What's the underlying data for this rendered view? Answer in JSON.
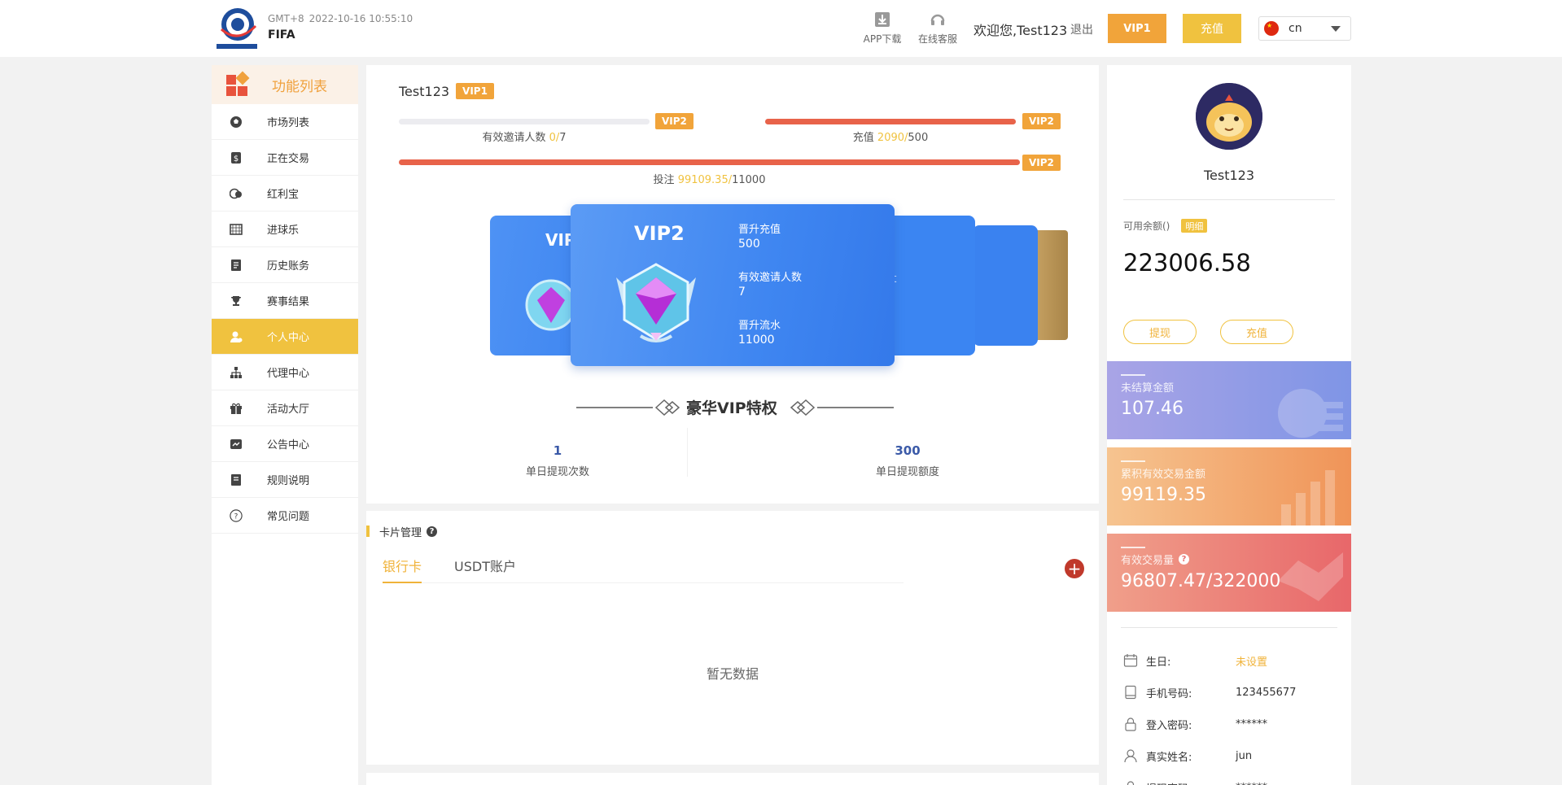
{
  "header": {
    "timezone": "GMT+8",
    "datetime": "2022-10-16 10:55:10",
    "brand": "FIFA",
    "app_download": "APP下载",
    "online_service": "在线客服",
    "welcome": "欢迎您,Test123",
    "logout": "退出",
    "vip_button": "VIP1",
    "recharge_button": "充值",
    "language": "cn"
  },
  "sidebar": {
    "title": "功能列表",
    "items": [
      {
        "label": "市场列表",
        "icon": "soccer-ball-icon"
      },
      {
        "label": "正在交易",
        "icon": "dollar-doc-icon"
      },
      {
        "label": "红利宝",
        "icon": "coins-icon"
      },
      {
        "label": "进球乐",
        "icon": "goal-net-icon"
      },
      {
        "label": "历史账务",
        "icon": "ledger-icon"
      },
      {
        "label": "赛事结果",
        "icon": "trophy-icon"
      },
      {
        "label": "个人中心",
        "icon": "user-icon",
        "active": true
      },
      {
        "label": "代理中心",
        "icon": "org-chart-icon"
      },
      {
        "label": "活动大厅",
        "icon": "gift-icon"
      },
      {
        "label": "公告中心",
        "icon": "announcement-icon"
      },
      {
        "label": "规则说明",
        "icon": "rules-doc-icon"
      },
      {
        "label": "常见问题",
        "icon": "question-circle-icon"
      }
    ]
  },
  "vip": {
    "username": "Test123",
    "current_level": "VIP1",
    "invite": {
      "label": "有效邀请人数",
      "current": "0",
      "sep": "/",
      "target": "7",
      "tag": "VIP2",
      "progress": 0
    },
    "recharge": {
      "label": "充值",
      "current": "2090",
      "sep": "/",
      "target": "500",
      "tag": "VIP2",
      "progress": 1
    },
    "bet": {
      "label": "投注",
      "current": "99109.35",
      "sep": "/",
      "target": "11000",
      "tag": "VIP2",
      "progress": 1
    },
    "card": {
      "title": "VIP2",
      "left_title": "VIP",
      "right_peek": "t",
      "req_recharge_label": "晋升充值",
      "req_recharge_value": "500",
      "req_invite_label": "有效邀请人数",
      "req_invite_value": "7",
      "req_flow_label": "晋升流水",
      "req_flow_value": "11000"
    },
    "privilege_title": "豪华VIP特权",
    "stats": [
      {
        "value": "1",
        "label": "单日提现次数"
      },
      {
        "value": "300",
        "label": "单日提现额度"
      }
    ]
  },
  "cards_panel": {
    "title": "卡片管理",
    "help": "?",
    "tabs": [
      "银行卡",
      "USDT账户"
    ],
    "add": "+",
    "empty": "暂无数据"
  },
  "profile": {
    "name": "Test123",
    "balance_label": "可用余额()",
    "detail_tag": "明细",
    "balance": "223006.58",
    "withdraw": "提现",
    "recharge": "充值",
    "stat_cards": [
      {
        "label": "未结算金额",
        "value": "107.46"
      },
      {
        "label": "累积有效交易金额",
        "value": "99119.35"
      },
      {
        "label": "有效交易量",
        "value": "96807.47/322000",
        "help": "?"
      }
    ],
    "info": [
      {
        "label": "生日:",
        "value": "未设置",
        "icon": "calendar-icon"
      },
      {
        "label": "手机号码:",
        "value": "123455677",
        "icon": "phone-icon"
      },
      {
        "label": "登入密码:",
        "value": "******",
        "icon": "lock-icon"
      },
      {
        "label": "真实姓名:",
        "value": "jun",
        "icon": "person-icon"
      },
      {
        "label": "提现密码:",
        "value": "******",
        "icon": "lock-icon"
      }
    ]
  }
}
